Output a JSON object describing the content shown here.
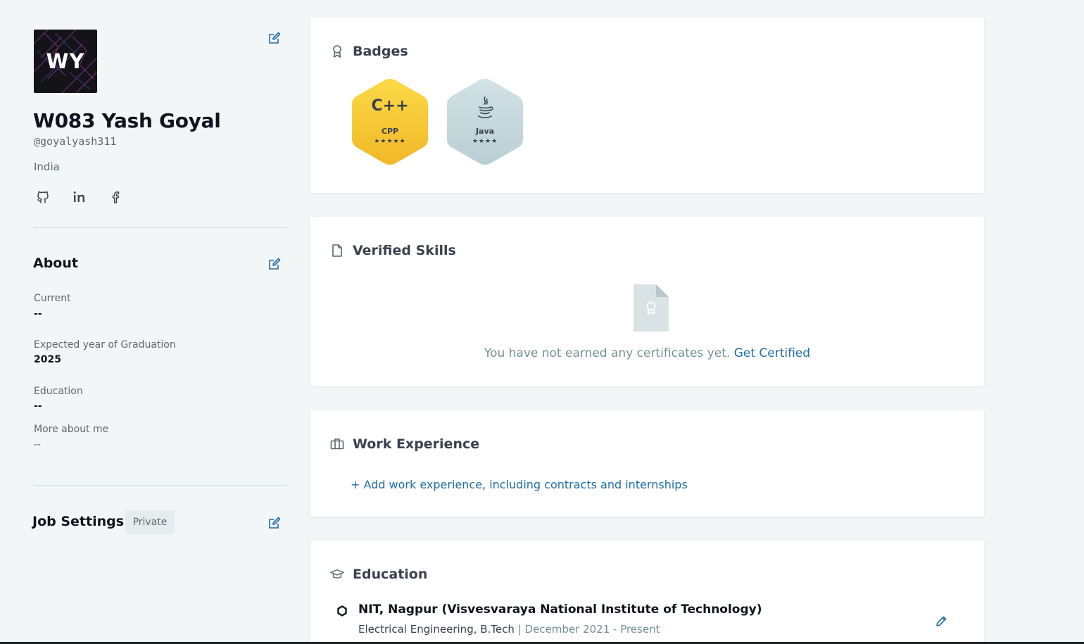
{
  "profile": {
    "initials": "WY",
    "name": "W083 Yash Goyal",
    "handle": "@goyalyash311",
    "country": "India",
    "social_icons": [
      "github-icon",
      "linkedin-icon",
      "facebook-icon"
    ]
  },
  "about": {
    "title": "About",
    "fields": [
      {
        "label": "Current",
        "value": "--"
      },
      {
        "label": "Expected year of Graduation",
        "value": "2025"
      },
      {
        "label": "Education",
        "value": "--"
      },
      {
        "label": "More about me",
        "value": "--"
      }
    ]
  },
  "job_settings": {
    "title": "Job Settings",
    "visibility": "Private"
  },
  "badges": {
    "title": "Badges",
    "items": [
      {
        "name": "CPP",
        "icon_text": "C++",
        "stars": "★★★★★",
        "color": "#f5c431"
      },
      {
        "name": "Java",
        "icon_text": "java-icon",
        "stars": "★★★★",
        "color": "#c5d8dd"
      }
    ]
  },
  "verified_skills": {
    "title": "Verified Skills",
    "message": "You have not earned any certificates yet.",
    "cta": "Get Certified"
  },
  "work_experience": {
    "title": "Work Experience",
    "add_label": "+ Add work experience, including contracts and internships"
  },
  "education": {
    "title": "Education",
    "institution": "NIT, Nagpur (Visvesvaraya National Institute of Technology)",
    "degree": "Electrical Engineering, B.Tech",
    "period": "December 2021 - Present"
  },
  "colors": {
    "background": "#f3f6f7",
    "link": "#1f6da6",
    "edit_icon": "#1f6da6",
    "gold_badge": "#f5c431",
    "silver_badge": "#c5d8dd"
  }
}
